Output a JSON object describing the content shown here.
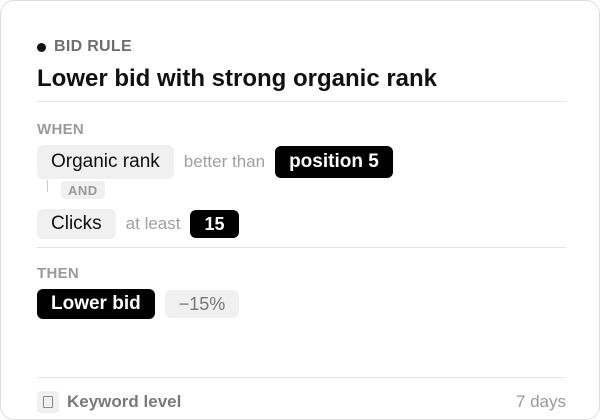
{
  "header": {
    "eyebrow": "BID RULE",
    "title": "Lower bid with strong organic rank"
  },
  "when": {
    "label": "WHEN",
    "conditions": [
      {
        "metric": "Organic rank",
        "operator": "better than",
        "value": "position 5"
      },
      {
        "metric": "Clicks",
        "operator": "at least",
        "value": "15"
      }
    ],
    "joiner": "AND"
  },
  "then": {
    "label": "THEN",
    "action": "Lower bid",
    "amount": "−15%"
  },
  "footer": {
    "level": "Keyword level",
    "period": "7 days"
  }
}
